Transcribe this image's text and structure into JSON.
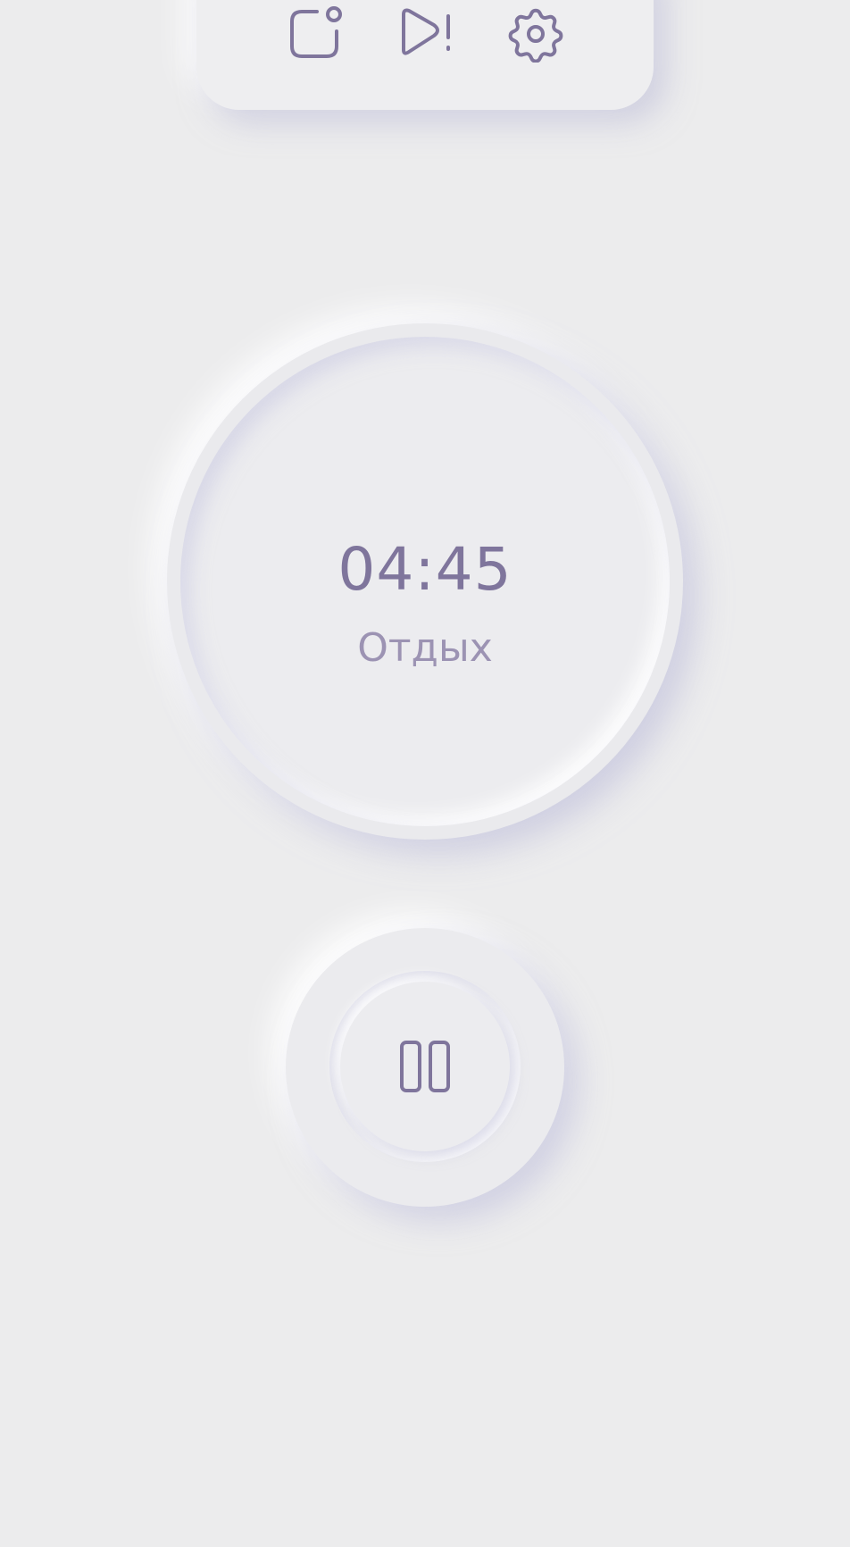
{
  "toolbar": {
    "buttons": [
      {
        "icon": "notes-icon"
      },
      {
        "icon": "play-alert-icon"
      },
      {
        "icon": "gear-icon"
      }
    ]
  },
  "timer": {
    "time": "04:45",
    "mode": "Отдых"
  },
  "controls": {
    "pause_icon": "pause-icon"
  },
  "colors": {
    "background": "#ececed",
    "accent": "#7f759c",
    "accent_light": "#9c93b3"
  }
}
